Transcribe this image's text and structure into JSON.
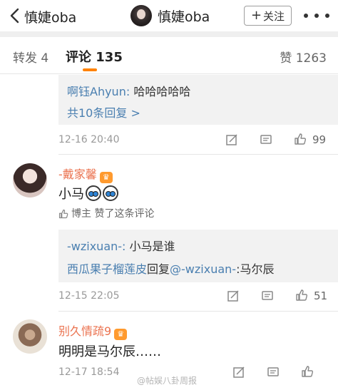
{
  "nav": {
    "back_title": "慎婕oba",
    "user_name": "慎婕oba",
    "follow_label": "关注",
    "follow_plus": "+"
  },
  "tabs": {
    "repost": "转发 4",
    "comments": "评论 135",
    "likes": "赞 1263"
  },
  "comment0": {
    "reply_author": "啊钰Ahyun:",
    "reply_text": " 哈哈哈哈哈",
    "more_replies": "共10条回复 >",
    "time": "12-16 20:40",
    "like_count": "99"
  },
  "comment1": {
    "author": "-戴家馨",
    "text": "小马",
    "emoji_count": 2,
    "liked_by_label": "博主 赞了这条评论",
    "reply1_author": "-wzixuan-:",
    "reply1_text": " 小马是谁",
    "reply2_author": "西瓜果子榴莲皮",
    "reply2_mid": "回复",
    "reply2_mention": "@-wzixuan-",
    "reply2_text": ":马尔辰",
    "time": "12-15 22:05",
    "like_count": "51"
  },
  "comment2": {
    "author": "别久情疏9",
    "text": "明明是马尔辰……",
    "time": "12-17 18:54"
  },
  "watermark": "@帖娱八卦周报",
  "colors": {
    "accent": "#ff8200",
    "username": "#eb7350",
    "link_blue": "#4a7fb0"
  }
}
